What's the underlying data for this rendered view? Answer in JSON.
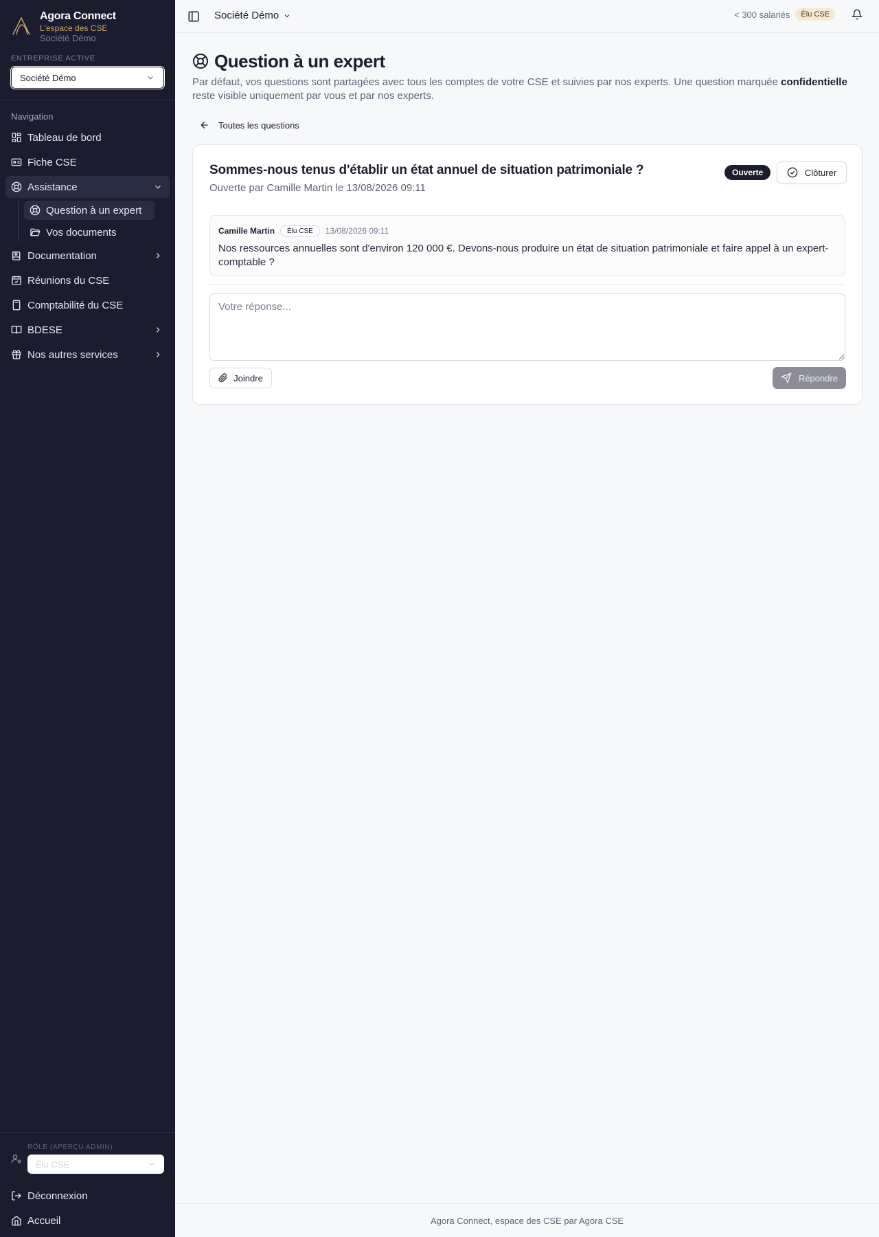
{
  "app": {
    "name": "Agora Connect",
    "tagline": "L'espace des CSE",
    "company": "Société Démo"
  },
  "sidebar": {
    "enterprise_label": "Entreprise active",
    "enterprise_value": "Société Démo",
    "nav_label": "Navigation",
    "items": [
      {
        "label": "Tableau de bord",
        "icon": "dashboard-icon"
      },
      {
        "label": "Fiche CSE",
        "icon": "id-card-icon"
      },
      {
        "label": "Assistance",
        "icon": "lifebuoy-icon",
        "expanded": true,
        "children": [
          {
            "label": "Question à un expert",
            "icon": "lifebuoy-icon",
            "active": true
          },
          {
            "label": "Vos documents",
            "icon": "folder-open-icon"
          }
        ]
      },
      {
        "label": "Documentation",
        "icon": "book-icon"
      },
      {
        "label": "Réunions du CSE",
        "icon": "calendar-check-icon"
      },
      {
        "label": "Comptabilité du CSE",
        "icon": "calculator-icon"
      },
      {
        "label": "BDESE",
        "icon": "book-open-icon"
      },
      {
        "label": "Nos autres services",
        "icon": "gift-icon"
      }
    ],
    "role_label": "Rôle (aperçu admin)",
    "role_value": "Élu CSE",
    "bottom": [
      {
        "label": "Déconnexion",
        "icon": "logout-icon"
      },
      {
        "label": "Accueil",
        "icon": "home-icon"
      }
    ]
  },
  "topbar": {
    "company": "Société Démo",
    "employee_count": "< 300 salariés",
    "role_badge": "Élu CSE"
  },
  "page": {
    "title": "Question à un expert",
    "desc_before": "Par défaut, vos questions sont partagées avec tous les comptes de votre CSE et suivies par nos experts. Une question marquée ",
    "desc_bold": "confidentielle",
    "desc_after": " reste visible uniquement par vous et par nos experts.",
    "back_label": "Toutes les questions"
  },
  "question": {
    "title": "Sommes-nous tenus d'établir un état annuel de situation patrimoniale ?",
    "meta": "Ouverte par Camille Martin le 13/08/2026 09:11",
    "status": "Ouverte",
    "close_label": "Clôturer",
    "message": {
      "author": "Camille Martin",
      "role": "Élu CSE",
      "date": "13/08/2026 09:11",
      "body": "Nos ressources annuelles sont d'environ 120 000 €. Devons-nous produire un état de situation patrimoniale et faire appel à un expert-comptable ?"
    },
    "reply_placeholder": "Votre réponse...",
    "attach_label": "Joindre",
    "reply_label": "Répondre"
  },
  "footer": {
    "text": "Agora Connect, espace des CSE par Agora CSE"
  },
  "colors": {
    "sidebar_bg": "#1b1c2e",
    "accent_gold": "#c9a66b",
    "status_badge_bg": "#1b1c2e"
  }
}
